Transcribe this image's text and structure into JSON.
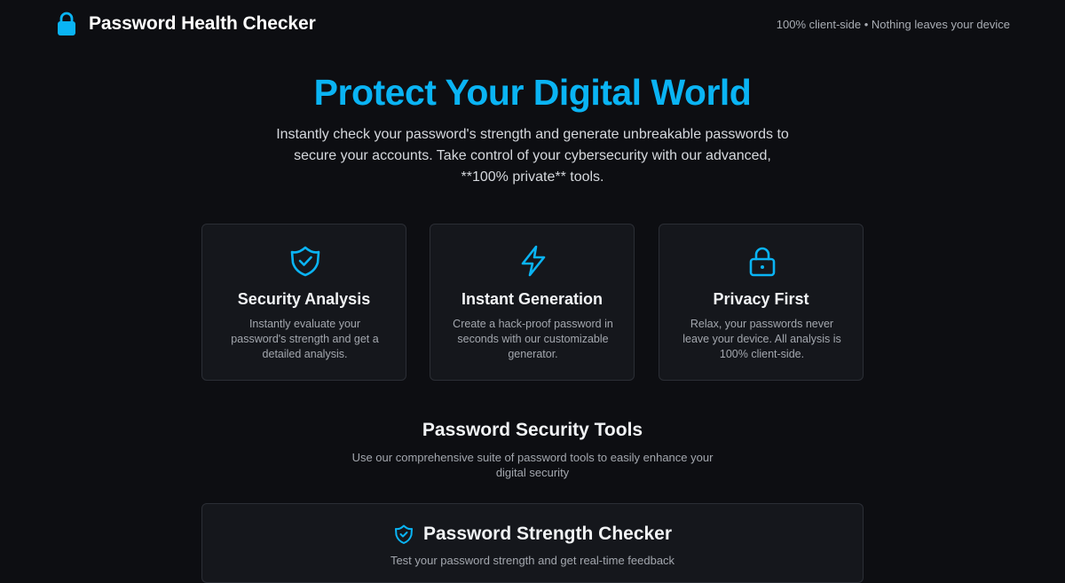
{
  "header": {
    "brand_icon": "lock-icon",
    "title": "Password Health Checker",
    "note": "100% client-side • Nothing leaves your device"
  },
  "hero": {
    "title": "Protect Your Digital World",
    "subtitle": "Instantly check your password's strength and generate unbreakable passwords to secure your accounts. Take control of your cybersecurity with our advanced, **100% private** tools."
  },
  "features": [
    {
      "icon": "shield-check-icon",
      "title": "Security Analysis",
      "description": "Instantly evaluate your password's strength and get a detailed analysis."
    },
    {
      "icon": "lightning-bolt-icon",
      "title": "Instant Generation",
      "description": "Create a hack-proof password in seconds with our customizable generator."
    },
    {
      "icon": "lock-icon",
      "title": "Privacy First",
      "description": "Relax, your passwords never leave your device. All analysis is 100% client-side."
    }
  ],
  "tools": {
    "title": "Password Security Tools",
    "subtitle": "Use our comprehensive suite of password tools to easily enhance your digital security"
  },
  "checker": {
    "icon": "shield-check-icon",
    "title": "Password Strength Checker",
    "description": "Test your password strength and get real-time feedback"
  },
  "colors": {
    "background": "#0d0e12",
    "accent": "#0ab4f4",
    "card": "#15171c",
    "card_border": "#2b2e35"
  }
}
